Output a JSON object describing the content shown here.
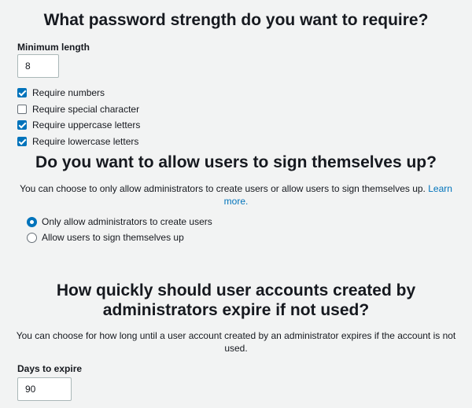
{
  "password_section": {
    "heading": "What password strength do you want to require?",
    "min_length_label": "Minimum length",
    "min_length_value": "8",
    "options": [
      {
        "label": "Require numbers",
        "checked": true
      },
      {
        "label": "Require special character",
        "checked": false
      },
      {
        "label": "Require uppercase letters",
        "checked": true
      },
      {
        "label": "Require lowercase letters",
        "checked": true
      }
    ]
  },
  "signup_section": {
    "heading": "Do you want to allow users to sign themselves up?",
    "description": "You can choose to only allow administrators to create users or allow users to sign themselves up.",
    "learn_more_link": "Learn more.",
    "options": [
      {
        "label": "Only allow administrators to create users",
        "selected": true
      },
      {
        "label": "Allow users to sign themselves up",
        "selected": false
      }
    ]
  },
  "expiry_section": {
    "heading_line1": "How quickly should user accounts created by",
    "heading_line2": "administrators expire if not used?",
    "description": "You can choose for how long until a user account created by an administrator expires if the account is not used.",
    "days_label": "Days to expire",
    "days_value": "90"
  },
  "colors": {
    "accent": "#0073bb",
    "background": "#f2f3f3",
    "text": "#16191f"
  }
}
